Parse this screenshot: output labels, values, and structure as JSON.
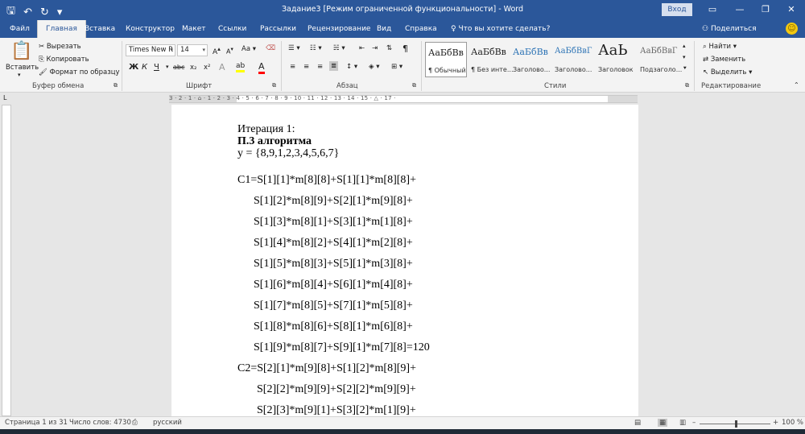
{
  "titlebar": {
    "qat": {
      "save": "🖫",
      "undo": "↶",
      "redo": "↻",
      "customize": "▾"
    },
    "title": "Задание3 [Режим ограниченной функциональности]  -  Word",
    "signin": "Вход",
    "buttons": {
      "ribbon_options": "▭",
      "minimize": "—",
      "maximize": "❐",
      "close": "✕"
    }
  },
  "tabs": [
    "Файл",
    "Главная",
    "Вставка",
    "Конструктор",
    "Макет",
    "Ссылки",
    "Рассылки",
    "Рецензирование",
    "Вид",
    "Справка"
  ],
  "active_tab": "Главная",
  "tell_me": "Что вы хотите сделать?",
  "share": "Поделиться",
  "ribbon": {
    "clipboard": {
      "paste": "Вставить",
      "cut": "Вырезать",
      "copy": "Копировать",
      "format_painter": "Формат по образцу",
      "label": "Буфер обмена"
    },
    "font": {
      "name": "Times New R",
      "size": "14",
      "label": "Шрифт",
      "bold": "Ж",
      "italic": "К",
      "underline": "Ч",
      "strike": "abc",
      "sub": "x₂",
      "sup": "x²",
      "case": "Aa",
      "grow": "A",
      "shrink": "A",
      "clear": "A",
      "color": "A",
      "highlight": "ab"
    },
    "paragraph": {
      "label": "Абзац",
      "pilcrow": "¶"
    },
    "styles": {
      "label": "Стили",
      "items": [
        {
          "sample": "АаБбВв",
          "name": "¶ Обычный"
        },
        {
          "sample": "АаБбВв",
          "name": "¶ Без инте..."
        },
        {
          "sample": "АаБбВв",
          "name": "Заголово..."
        },
        {
          "sample": "АаБбВвГ",
          "name": "Заголово..."
        },
        {
          "sample": "АаЬ",
          "name": "Заголовок"
        },
        {
          "sample": "АаБбВвГ",
          "name": "Подзаголо..."
        }
      ]
    },
    "editing": {
      "find": "Найти",
      "replace": "Заменить",
      "select": "Выделить",
      "label": "Редактирование"
    }
  },
  "ruler": {
    "numbers": "3 · 2 · 1 · ⌂ · 1 · 2 · 3 · 4 · 5 · 6 · 7 · 8 · 9 · 10 · 11 · 12 · 13 · 14 · 15 · △ · 17 ·",
    "corner": "L"
  },
  "document": {
    "lines": [
      "Итерация 1:",
      "П.3 алгоритма",
      "y = {8,9,1,2,3,4,5,6,7}",
      "C1=S[1][1]*m[8][8]+S[1][1]*m[8][8]+",
      "S[1][2]*m[8][9]+S[2][1]*m[9][8]+",
      "S[1][3]*m[8][1]+S[3][1]*m[1][8]+",
      "S[1][4]*m[8][2]+S[4][1]*m[2][8]+",
      "S[1][5]*m[8][3]+S[5][1]*m[3][8]+",
      "S[1][6]*m[8][4]+S[6][1]*m[4][8]+",
      "S[1][7]*m[8][5]+S[7][1]*m[5][8]+",
      "S[1][8]*m[8][6]+S[8][1]*m[6][8]+",
      "S[1][9]*m[8][7]+S[9][1]*m[7][8]=120",
      "C2=S[2][1]*m[9][8]+S[1][2]*m[8][9]+",
      "S[2][2]*m[9][9]+S[2][2]*m[9][9]+",
      "S[2][3]*m[9][1]+S[3][2]*m[1][9]+"
    ]
  },
  "statusbar": {
    "page": "Страница 1 из 31",
    "words": "Число слов: 4730",
    "language": "русский",
    "zoom": "100 %",
    "zoom_minus": "–",
    "zoom_plus": "+",
    "zoom_level": 1.0
  }
}
